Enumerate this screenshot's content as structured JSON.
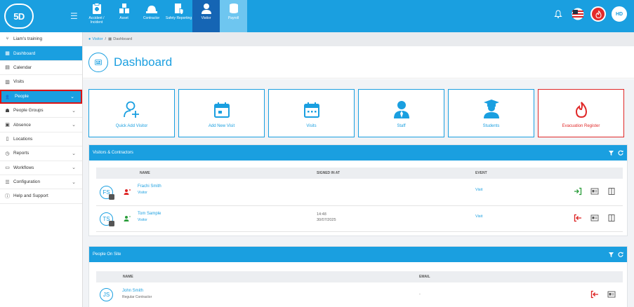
{
  "header": {
    "logo_text": "5D",
    "modules": [
      {
        "label": "Accident / Incident",
        "icon": "incident-icon"
      },
      {
        "label": "Asset",
        "icon": "asset-icon"
      },
      {
        "label": "Contractor",
        "icon": "contractor-icon"
      },
      {
        "label": "Safety Reporting",
        "icon": "safety-icon"
      },
      {
        "label": "Visitor",
        "icon": "visitor-icon",
        "state": "active"
      },
      {
        "label": "Payroll",
        "icon": "payroll-icon",
        "state": "faded"
      }
    ],
    "user_initials": "HD",
    "colors": {
      "brand": "#1a9fe0",
      "active_module": "#1565b4",
      "alarm": "#e32a2a"
    }
  },
  "sidebar": {
    "items": [
      {
        "label": "Liam's training",
        "icon": "branch-icon"
      },
      {
        "label": "Dashboard",
        "icon": "dashboard-icon",
        "state": "active"
      },
      {
        "label": "Calendar",
        "icon": "calendar-icon"
      },
      {
        "label": "Visits",
        "icon": "visits-icon"
      },
      {
        "label": "People",
        "icon": "people-icon",
        "state": "highlighted",
        "expandable": true
      },
      {
        "label": "People Groups",
        "icon": "people-groups-icon",
        "expandable": true
      },
      {
        "label": "Absence",
        "icon": "absence-icon",
        "expandable": true
      },
      {
        "label": "Locations",
        "icon": "locations-icon"
      },
      {
        "label": "Reports",
        "icon": "reports-icon",
        "expandable": true
      },
      {
        "label": "Workflows",
        "icon": "workflows-icon",
        "expandable": true
      },
      {
        "label": "Configuration",
        "icon": "configuration-icon",
        "expandable": true
      },
      {
        "label": "Help and Support",
        "icon": "help-icon"
      }
    ]
  },
  "breadcrumb": {
    "items": [
      "Visitor",
      "Dashboard"
    ],
    "separator": "/"
  },
  "page": {
    "title": "Dashboard"
  },
  "tiles": [
    {
      "label": "Quick Add Visitor",
      "icon": "add-person-icon"
    },
    {
      "label": "Add New Visit",
      "icon": "calendar-add-icon"
    },
    {
      "label": "Visits",
      "icon": "calendar-icon"
    },
    {
      "label": "Staff",
      "icon": "staff-icon"
    },
    {
      "label": "Students",
      "icon": "students-icon"
    },
    {
      "label": "Evacuation Register",
      "icon": "flame-icon",
      "color": "#e02828"
    }
  ],
  "visitors_panel": {
    "title": "Visitors & Contractors",
    "columns": [
      "NAME",
      "SIGNED IN AT",
      "EVENT"
    ],
    "rows": [
      {
        "initials": "FS",
        "name": "Frachi Smith",
        "type": "Visitor",
        "signed_in_time": "",
        "signed_in_date": "",
        "event": "Visit",
        "status_icon": "person-red-icon",
        "action_icon": "sign-in-icon"
      },
      {
        "initials": "TS",
        "name": "Tom Sample",
        "type": "Visitor",
        "signed_in_time": "14:48",
        "signed_in_date": "30/07/2025",
        "event": "Visit",
        "status_icon": "person-green-icon",
        "action_icon": "sign-out-icon"
      }
    ]
  },
  "onsite_panel": {
    "title": "People On Site",
    "columns": [
      "NAME",
      "EMAIL"
    ],
    "rows": [
      {
        "initials": "JS",
        "name": "John Smith",
        "type": "Regular Contractor",
        "email": "-"
      }
    ]
  }
}
